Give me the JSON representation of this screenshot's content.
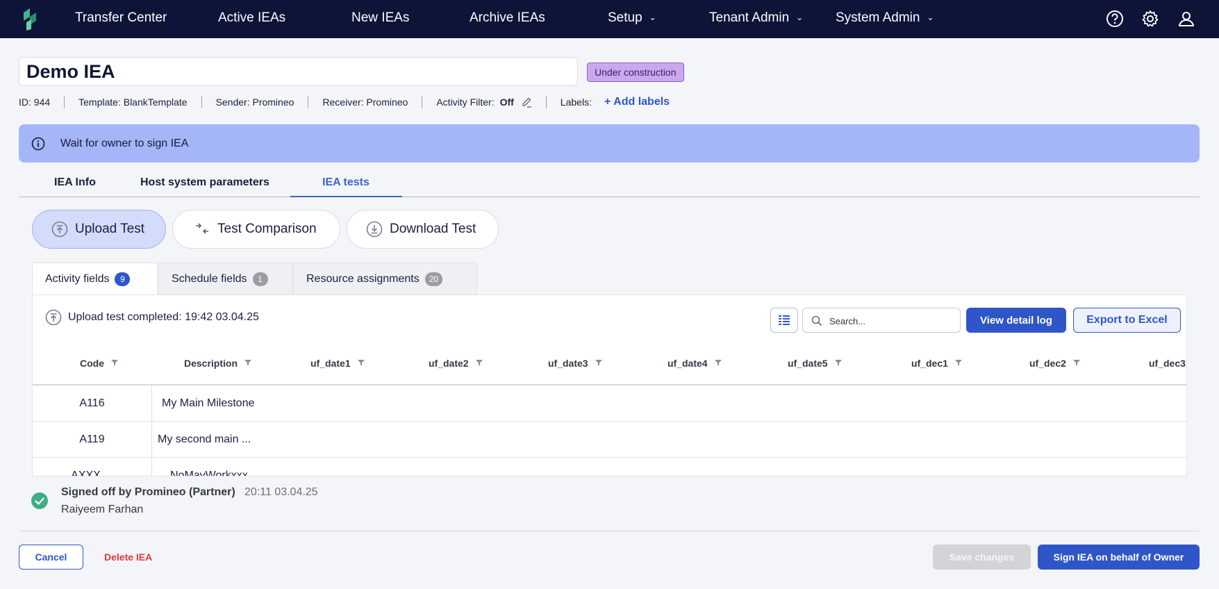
{
  "nav": {
    "items": [
      "Transfer Center",
      "Active IEAs",
      "New IEAs",
      "Archive IEAs"
    ],
    "dropdowns": [
      "Setup",
      "Tenant Admin",
      "System Admin"
    ]
  },
  "header": {
    "title": "Demo IEA",
    "status": "Under construction",
    "meta": {
      "id": "ID: 944",
      "template": "Template: BlankTemplate",
      "sender": "Sender: Promineo",
      "receiver": "Receiver: Promineo",
      "activity_filter_label": "Activity Filter:",
      "activity_filter_value": "Off",
      "labels_label": "Labels:",
      "add_labels": "+ Add labels"
    }
  },
  "banner": {
    "text": "Wait for owner to sign IEA"
  },
  "main_tabs": [
    "IEA Info",
    "Host system parameters",
    "IEA tests"
  ],
  "actions": [
    "Upload Test",
    "Test Comparison",
    "Download Test"
  ],
  "sub_tabs": [
    {
      "label": "Activity fields",
      "count": "9"
    },
    {
      "label": "Schedule fields",
      "count": "1"
    },
    {
      "label": "Resource assignments",
      "count": "20"
    }
  ],
  "panel": {
    "upload_status": "Upload test completed: 19:42 03.04.25",
    "search_placeholder": "Search...",
    "view_log": "View detail log",
    "export": "Export to Excel"
  },
  "table": {
    "columns": [
      "Code",
      "Description",
      "uf_date1",
      "uf_date2",
      "uf_date3",
      "uf_date4",
      "uf_date5",
      "uf_dec1",
      "uf_dec2",
      "uf_dec3"
    ],
    "rows": [
      {
        "code": "A116",
        "description": "My Main Milestone"
      },
      {
        "code": "A119",
        "description": "My second main ..."
      },
      {
        "code": "AXXX",
        "description": "NoMayWorkxxx"
      }
    ]
  },
  "signoff": {
    "title": "Signed off by Promineo (Partner)",
    "time": "20:11 03.04.25",
    "name": "Raiyeem Farhan"
  },
  "footer": {
    "cancel": "Cancel",
    "delete": "Delete IEA",
    "save": "Save changes",
    "sign": "Sign IEA on behalf of Owner"
  },
  "colors": {
    "nav_bg": "#0e1438",
    "accent": "#2f56c8",
    "banner": "#a4b5f8",
    "status_badge": "#c9a8ee",
    "danger": "#e0353d",
    "success": "#3fae83"
  },
  "icons": [
    "app-logo-icon",
    "help-icon",
    "gear-icon",
    "user-icon",
    "info-icon",
    "pencil-icon",
    "upload-icon",
    "compare-icon",
    "download-icon",
    "columns-icon",
    "search-icon",
    "filter-icon",
    "check-circle-icon",
    "chevron-down-icon"
  ]
}
